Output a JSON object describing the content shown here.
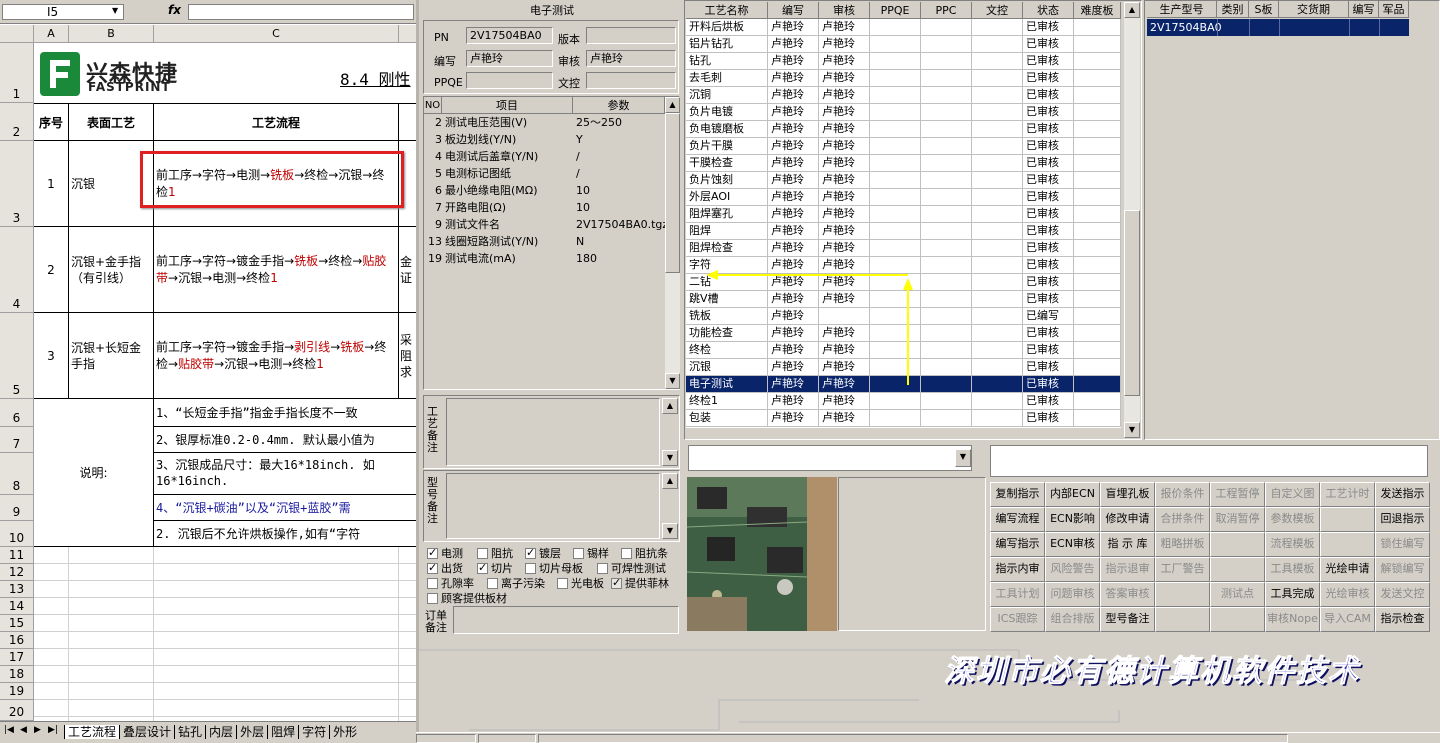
{
  "excel": {
    "name_box": "I5",
    "fx_label": "fx",
    "columns": [
      "A",
      "B",
      "C"
    ],
    "row_numbers": [
      "1",
      "2",
      "3",
      "4",
      "5",
      "6",
      "7",
      "8",
      "9",
      "10",
      "11",
      "12",
      "13",
      "14",
      "15",
      "16",
      "17",
      "18",
      "19",
      "20"
    ],
    "logo_cn": "兴森快捷",
    "logo_en": "FASTPRINT",
    "section_title": "8.4 刚性",
    "headers": {
      "seq": "序号",
      "surface": "表面工艺",
      "flow": "工艺流程"
    },
    "rows": [
      {
        "seq": "1",
        "surface": "沉银",
        "flow_a": "前工序→字符→电测→",
        "flow_b": "铣板",
        "flow_c": "→终检→沉银→终检",
        "flow_d": "1"
      },
      {
        "seq": "2",
        "surface": "沉银+金手指（有引线）",
        "flow_a": "前工序→字符→镀金手指→",
        "flow_b": "铣板",
        "flow_c": "→终检→",
        "flow_d": "贴胶带",
        "flow_e": "→沉银→电测→终检",
        "flow_f": "1",
        "extra": "金证"
      },
      {
        "seq": "3",
        "surface": "沉银+长短金手指",
        "flow_a": "前工序→字符→镀金手指→",
        "flow_b": "剥引线",
        "flow_c": "→",
        "flow_d": "铣板",
        "flow_e": "→终检→",
        "flow_f": "贴胶带",
        "flow_g": "→沉银→电测→终检",
        "flow_h": "1",
        "extra": "采阻求"
      }
    ],
    "note_label": "说明:",
    "notes": [
      "1、“长短金手指”指金手指长度不一致",
      "2、银厚标准0.2-0.4mm. 默认最小值为",
      "3、沉银成品尺寸：最大16*18inch. 如",
      "16*16inch.",
      "4、“沉银+碳油”以及“沉银+蓝胶”需",
      "2. 沉银后不允许烘板操作,如有“字符"
    ],
    "sheet_tabs": [
      "工艺流程",
      "叠层设计",
      "钻孔",
      "内层",
      "外层",
      "阻焊",
      "字符",
      "外形"
    ]
  },
  "mid": {
    "title": "电子测试",
    "pn_label": "PN",
    "pn_value": "2V17504BA0",
    "version_label": "版本",
    "version_value": "",
    "writer_label": "编写",
    "writer_value": "卢艳玲",
    "reviewer_label": "审核",
    "reviewer_value": "卢艳玲",
    "ppqe_label": "PPQE",
    "ppqe_value": "",
    "wenkong_label": "文控",
    "wenkong_value": "",
    "param_headers": [
      "NO",
      "项目",
      "参数"
    ],
    "params": [
      {
        "no": "2",
        "item": "测试电压范围(V)",
        "value": "25～250"
      },
      {
        "no": "3",
        "item": "板边划线(Y/N)",
        "value": "Y"
      },
      {
        "no": "4",
        "item": "电测试后盖章(Y/N)",
        "value": "/"
      },
      {
        "no": "5",
        "item": "电测标记图纸",
        "value": "/"
      },
      {
        "no": "6",
        "item": "最小绝缘电阻(MΩ)",
        "value": "10"
      },
      {
        "no": "7",
        "item": "开路电阻(Ω)",
        "value": "10"
      },
      {
        "no": "9",
        "item": "测试文件名",
        "value": "2V17504BA0.tgz"
      },
      {
        "no": "13",
        "item": "线圈短路测试(Y/N)",
        "value": "N"
      },
      {
        "no": "19",
        "item": "测试电流(mA)",
        "value": "180"
      }
    ],
    "process_note_label": "工艺备注",
    "model_note_label": "型号备注",
    "order_note_label": "订单备注",
    "checkboxes": [
      {
        "label": "电测",
        "checked": true
      },
      {
        "label": "阻抗",
        "checked": false
      },
      {
        "label": "镀层",
        "checked": true
      },
      {
        "label": "锡样",
        "checked": false
      },
      {
        "label": "阻抗条",
        "checked": false
      },
      {
        "label": "出货",
        "checked": true
      },
      {
        "label": "切片",
        "checked": true
      },
      {
        "label": "切片母板",
        "checked": false
      },
      {
        "label": "可焊性测试",
        "checked": false
      },
      {
        "label": "孔隙率",
        "checked": false
      },
      {
        "label": "离子污染",
        "checked": false
      },
      {
        "label": "光电板",
        "checked": false
      },
      {
        "label": "提供菲林",
        "checked": true
      },
      {
        "label": "顾客提供板材",
        "checked": false
      }
    ]
  },
  "process": {
    "headers": [
      "工艺名称",
      "编写",
      "审核",
      "PPQE",
      "PPC",
      "文控",
      "状态",
      "难度板"
    ],
    "rows": [
      [
        "开料后烘板",
        "卢艳玲",
        "卢艳玲",
        "",
        "",
        "",
        "已审核",
        ""
      ],
      [
        "铝片钻孔",
        "卢艳玲",
        "卢艳玲",
        "",
        "",
        "",
        "已审核",
        ""
      ],
      [
        "钻孔",
        "卢艳玲",
        "卢艳玲",
        "",
        "",
        "",
        "已审核",
        ""
      ],
      [
        "去毛刺",
        "卢艳玲",
        "卢艳玲",
        "",
        "",
        "",
        "已审核",
        ""
      ],
      [
        "沉铜",
        "卢艳玲",
        "卢艳玲",
        "",
        "",
        "",
        "已审核",
        ""
      ],
      [
        "负片电镀",
        "卢艳玲",
        "卢艳玲",
        "",
        "",
        "",
        "已审核",
        ""
      ],
      [
        "负电镀磨板",
        "卢艳玲",
        "卢艳玲",
        "",
        "",
        "",
        "已审核",
        ""
      ],
      [
        "负片干膜",
        "卢艳玲",
        "卢艳玲",
        "",
        "",
        "",
        "已审核",
        ""
      ],
      [
        "干膜检查",
        "卢艳玲",
        "卢艳玲",
        "",
        "",
        "",
        "已审核",
        ""
      ],
      [
        "负片蚀刻",
        "卢艳玲",
        "卢艳玲",
        "",
        "",
        "",
        "已审核",
        ""
      ],
      [
        "外层AOI",
        "卢艳玲",
        "卢艳玲",
        "",
        "",
        "",
        "已审核",
        ""
      ],
      [
        "阻焊塞孔",
        "卢艳玲",
        "卢艳玲",
        "",
        "",
        "",
        "已审核",
        ""
      ],
      [
        "阻焊",
        "卢艳玲",
        "卢艳玲",
        "",
        "",
        "",
        "已审核",
        ""
      ],
      [
        "阻焊检查",
        "卢艳玲",
        "卢艳玲",
        "",
        "",
        "",
        "已审核",
        ""
      ],
      [
        "字符",
        "卢艳玲",
        "卢艳玲",
        "",
        "",
        "",
        "已审核",
        ""
      ],
      [
        "二钻",
        "卢艳玲",
        "卢艳玲",
        "",
        "",
        "",
        "已审核",
        ""
      ],
      [
        "跳V槽",
        "卢艳玲",
        "卢艳玲",
        "",
        "",
        "",
        "已审核",
        ""
      ],
      [
        "铣板",
        "卢艳玲",
        "",
        "",
        "",
        "",
        "已编写",
        ""
      ],
      [
        "功能检查",
        "卢艳玲",
        "卢艳玲",
        "",
        "",
        "",
        "已审核",
        ""
      ],
      [
        "终检",
        "卢艳玲",
        "卢艳玲",
        "",
        "",
        "",
        "已审核",
        ""
      ],
      [
        "沉银",
        "卢艳玲",
        "卢艳玲",
        "",
        "",
        "",
        "已审核",
        ""
      ],
      [
        "电子测试",
        "卢艳玲",
        "卢艳玲",
        "",
        "",
        "",
        "已审核",
        ""
      ],
      [
        "终检1",
        "卢艳玲",
        "卢艳玲",
        "",
        "",
        "",
        "已审核",
        ""
      ],
      [
        "包装",
        "卢艳玲",
        "卢艳玲",
        "",
        "",
        "",
        "已审核",
        ""
      ]
    ],
    "selected_index": 21
  },
  "orders": {
    "headers": [
      "生产型号",
      "类别",
      "S板",
      "交货期",
      "编写",
      "军品"
    ],
    "rows": [
      [
        "2V17504BA0",
        "",
        "",
        "",
        "",
        ""
      ]
    ]
  },
  "buttons": [
    [
      {
        "l": "复制指示",
        "e": true
      },
      {
        "l": "内部ECN",
        "e": true
      },
      {
        "l": "盲埋孔板",
        "e": true
      },
      {
        "l": "报价条件",
        "e": false
      },
      {
        "l": "工程暂停",
        "e": false
      },
      {
        "l": "自定义图",
        "e": false
      },
      {
        "l": "工艺计时",
        "e": false
      },
      {
        "l": "发送指示",
        "e": true
      }
    ],
    [
      {
        "l": "编写流程",
        "e": true
      },
      {
        "l": "ECN影响",
        "e": true
      },
      {
        "l": "修改申请",
        "e": true
      },
      {
        "l": "合拼条件",
        "e": false
      },
      {
        "l": "取消暂停",
        "e": false
      },
      {
        "l": "参数模板",
        "e": false
      },
      {
        "l": "",
        "e": false
      },
      {
        "l": "回退指示",
        "e": true
      }
    ],
    [
      {
        "l": "编写指示",
        "e": true
      },
      {
        "l": "ECN审核",
        "e": true
      },
      {
        "l": "指 示 库",
        "e": true
      },
      {
        "l": "粗略拼板",
        "e": false
      },
      {
        "l": "",
        "e": false
      },
      {
        "l": "流程模板",
        "e": false
      },
      {
        "l": "",
        "e": false
      },
      {
        "l": "锁住编写",
        "e": false
      }
    ],
    [
      {
        "l": "指示内审",
        "e": true
      },
      {
        "l": "风险警告",
        "e": false
      },
      {
        "l": "指示退审",
        "e": false
      },
      {
        "l": "工厂警告",
        "e": false
      },
      {
        "l": "",
        "e": false
      },
      {
        "l": "工具模板",
        "e": false
      },
      {
        "l": "光绘申请",
        "e": true
      },
      {
        "l": "解锁编写",
        "e": false
      }
    ],
    [
      {
        "l": "工具计划",
        "e": false
      },
      {
        "l": "问题审核",
        "e": false
      },
      {
        "l": "答案审核",
        "e": false
      },
      {
        "l": "",
        "e": false
      },
      {
        "l": "测试点",
        "e": false
      },
      {
        "l": "工具完成",
        "e": true
      },
      {
        "l": "光绘审核",
        "e": false
      },
      {
        "l": "发送文控",
        "e": false
      }
    ],
    [
      {
        "l": "ICS跟踪",
        "e": false
      },
      {
        "l": "组合排版",
        "e": false
      },
      {
        "l": "型号备注",
        "e": true
      },
      {
        "l": "",
        "e": false
      },
      {
        "l": "",
        "e": false
      },
      {
        "l": "审核Nope",
        "e": false
      },
      {
        "l": "导入CAM",
        "e": false
      },
      {
        "l": "指示检查",
        "e": true
      }
    ]
  ],
  "banner_text": "深圳市必有德计算机软件技术",
  "colors": {
    "selection": "#0a246a",
    "highlight_red": "#e02020",
    "arrow_yellow": "#ffff00",
    "banner_blue": "#3030c0"
  }
}
